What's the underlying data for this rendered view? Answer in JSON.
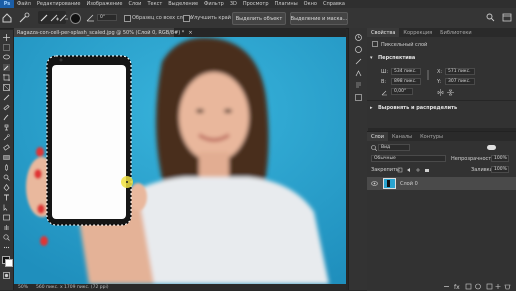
{
  "app": {
    "logo": "Ps"
  },
  "menu": [
    "Файл",
    "Редактирование",
    "Изображение",
    "Слои",
    "Текст",
    "Выделение",
    "Фильтр",
    "3D",
    "Просмотр",
    "Плагины",
    "Окно",
    "Справка"
  ],
  "options": {
    "angle_value": "0°",
    "sample_all_layers": "Образец со всех слоев",
    "enhance_edge": "Улучшить край",
    "select_subject": "Выделить объект",
    "select_and_mask": "Выделение и маска..."
  },
  "document": {
    "tab_title": "Ragazza-con-cell-per-splash_scaled.jpg @ 50% (Слой 0, RGB/8#) *",
    "tab_close": "×",
    "zoom": "50%",
    "doc_info": "560 пикс. x 1709 пикс. (72 ppi)"
  },
  "properties": {
    "tabs": [
      "Свойства",
      "Коррекция",
      "Библиотеки"
    ],
    "active_tab": 0,
    "layer_type": "Пиксельный слой",
    "transform_section": "Перспектива",
    "w_label": "Ш:",
    "w_value": "534 пикс.",
    "x_label": "X:",
    "x_value": "571 пикс.",
    "h_label": "В:",
    "h_value": "898 пикс.",
    "y_label": "Y:",
    "y_value": "307 пикс.",
    "angle_value": "0,00°",
    "align_section": "Выровнять и распределить"
  },
  "layers": {
    "tabs": [
      "Слои",
      "Каналы",
      "Контуры"
    ],
    "active_tab": 0,
    "filter_kind": "Вид",
    "blend_mode": "Обычные",
    "opacity_label": "Непрозрачность:",
    "opacity_value": "100%",
    "lock_label": "Закрепить:",
    "fill_label": "Заливка:",
    "fill_value": "100%",
    "items": [
      {
        "name": "Слой 0"
      }
    ]
  },
  "colors": {
    "accent": "#29a3cf",
    "panel": "#323232",
    "selected_layer": "#4a4a4a"
  }
}
